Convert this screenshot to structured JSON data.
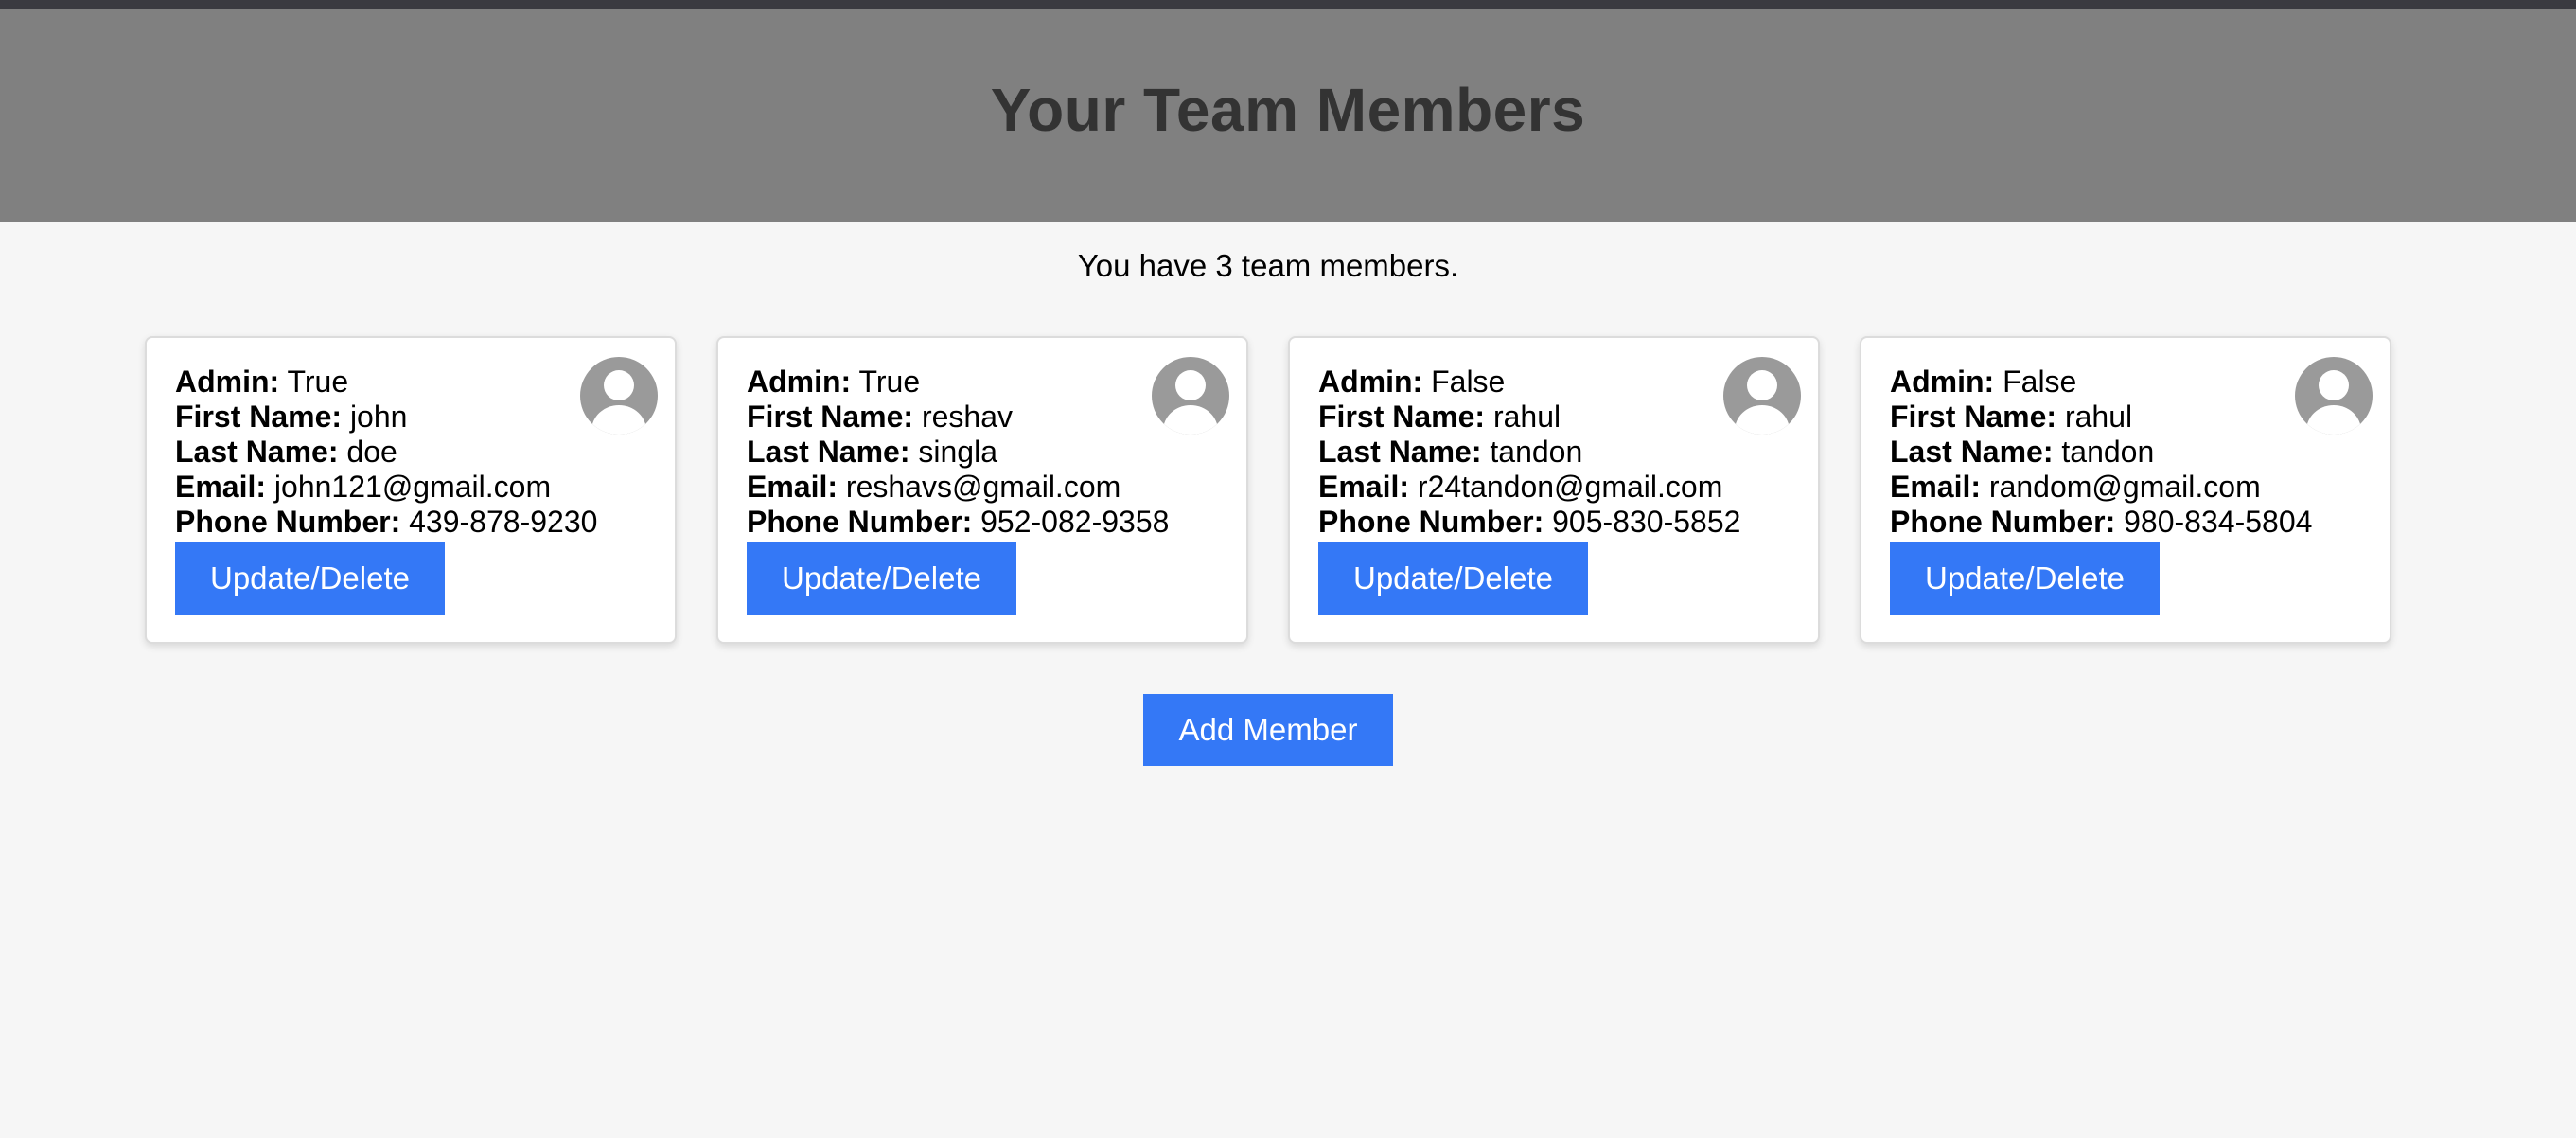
{
  "page": {
    "title": "Your Team Members",
    "count_text": "You have 3 team members."
  },
  "labels": {
    "admin": "Admin:",
    "first_name": "First Name:",
    "last_name": "Last Name:",
    "email": "Email:",
    "phone": "Phone Number:"
  },
  "members": [
    {
      "admin": "True",
      "first_name": "john",
      "last_name": "doe",
      "email": "john121@gmail.com",
      "phone": "439-878-9230",
      "button_label": "Update/Delete",
      "avatar_icon": "user-avatar-icon"
    },
    {
      "admin": "True",
      "first_name": "reshav",
      "last_name": "singla",
      "email": "reshavs@gmail.com",
      "phone": "952-082-9358",
      "button_label": "Update/Delete",
      "avatar_icon": "user-avatar-icon"
    },
    {
      "admin": "False",
      "first_name": "rahul",
      "last_name": "tandon",
      "email": "r24tandon@gmail.com",
      "phone": "905-830-5852",
      "button_label": "Update/Delete",
      "avatar_icon": "user-avatar-icon"
    },
    {
      "admin": "False",
      "first_name": "rahul",
      "last_name": "tandon",
      "email": "random@gmail.com",
      "phone": "980-834-5804",
      "button_label": "Update/Delete",
      "avatar_icon": "user-avatar-icon"
    }
  ],
  "actions": {
    "add_member_label": "Add Member"
  },
  "colors": {
    "header_bg": "#808080",
    "title_text": "#333333",
    "page_bg": "#f6f6f6",
    "button_bg": "#3478f6",
    "button_text": "#ffffff",
    "avatar_bg": "#9a9a9a"
  }
}
